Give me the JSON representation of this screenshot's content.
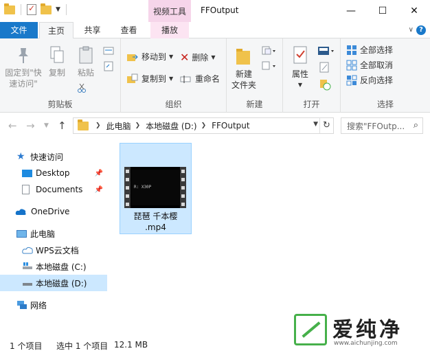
{
  "titlebar": {
    "context_tab": "视频工具",
    "window_title": "FFOutput",
    "minimize": "—",
    "maximize": "☐",
    "close": "✕"
  },
  "tabs": {
    "file": "文件",
    "home": "主页",
    "share": "共享",
    "view": "查看",
    "play": "播放",
    "collapse": "∨",
    "help": "?"
  },
  "ribbon": {
    "clipboard": {
      "label": "剪贴板",
      "pin_quick": "固定到\"快\n速访问\"",
      "copy": "复制",
      "paste": "粘贴"
    },
    "organize": {
      "label": "组织",
      "move_to": "移动到",
      "copy_to": "复制到",
      "delete": "删除",
      "rename": "重命名"
    },
    "new": {
      "label": "新建",
      "new_folder": "新建\n文件夹"
    },
    "open": {
      "label": "打开",
      "properties": "属性"
    },
    "select": {
      "label": "选择",
      "select_all": "全部选择",
      "select_none": "全部取消",
      "invert": "反向选择"
    }
  },
  "address": {
    "crumbs": [
      "此电脑",
      "本地磁盘 (D:)",
      "FFOutput"
    ],
    "search_placeholder": "搜索\"FFOutp..."
  },
  "sidebar": {
    "items": [
      {
        "label": "快速访问"
      },
      {
        "label": "Desktop"
      },
      {
        "label": "Documents"
      },
      {
        "label": "OneDrive"
      },
      {
        "label": "此电脑"
      },
      {
        "label": "WPS云文档"
      },
      {
        "label": "本地磁盘 (C:)"
      },
      {
        "label": "本地磁盘 (D:)"
      },
      {
        "label": "网络"
      }
    ]
  },
  "file": {
    "name_line1": "琵琶 千本樱",
    "name_line2": ".mp4",
    "thumb_text": "R: X30P"
  },
  "status": {
    "count": "1 个项目",
    "selected": "选中 1 个项目",
    "size": "12.1 MB"
  },
  "watermark": {
    "text": "爱纯净",
    "url": "www.aichunjing.com"
  }
}
